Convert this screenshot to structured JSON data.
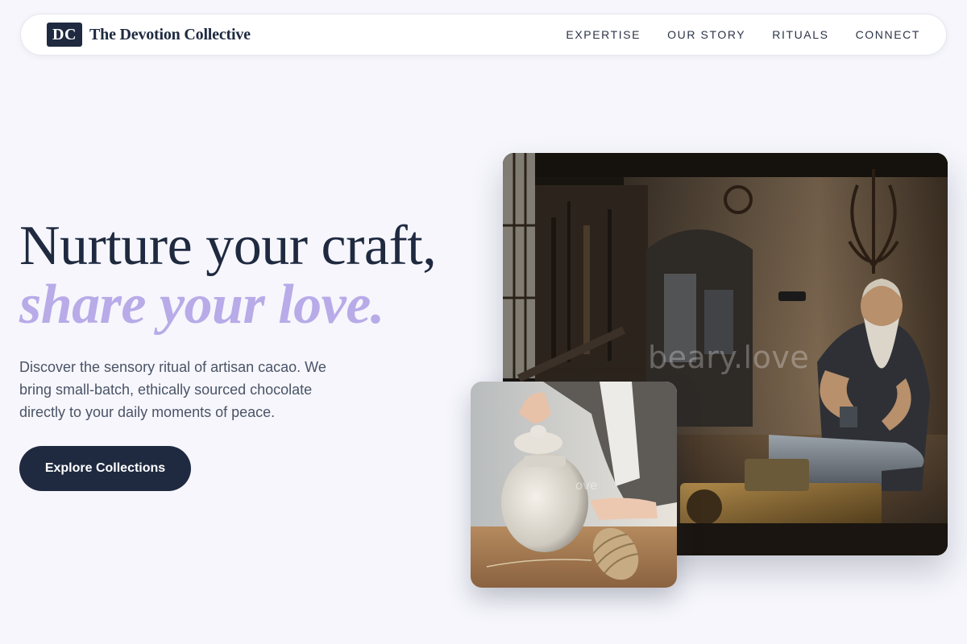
{
  "brand": {
    "mark": "DC",
    "name": "The Devotion Collective"
  },
  "nav": {
    "links": [
      "EXPERTISE",
      "OUR STORY",
      "RITUALS",
      "CONNECT"
    ]
  },
  "hero": {
    "title_line1": "Nurture your craft,",
    "title_line2": "share your love.",
    "description": "Discover the sensory ritual of artisan cacao. We bring small-batch, ethically sourced chocolate directly to your daily moments of peace.",
    "cta_label": "Explore Collections"
  },
  "images": {
    "main_watermark": "beary.love",
    "small_watermark": "ove"
  },
  "colors": {
    "primary": "#1f2a40",
    "accent_lavender": "#b8abe8",
    "background": "#f6f6fc"
  }
}
